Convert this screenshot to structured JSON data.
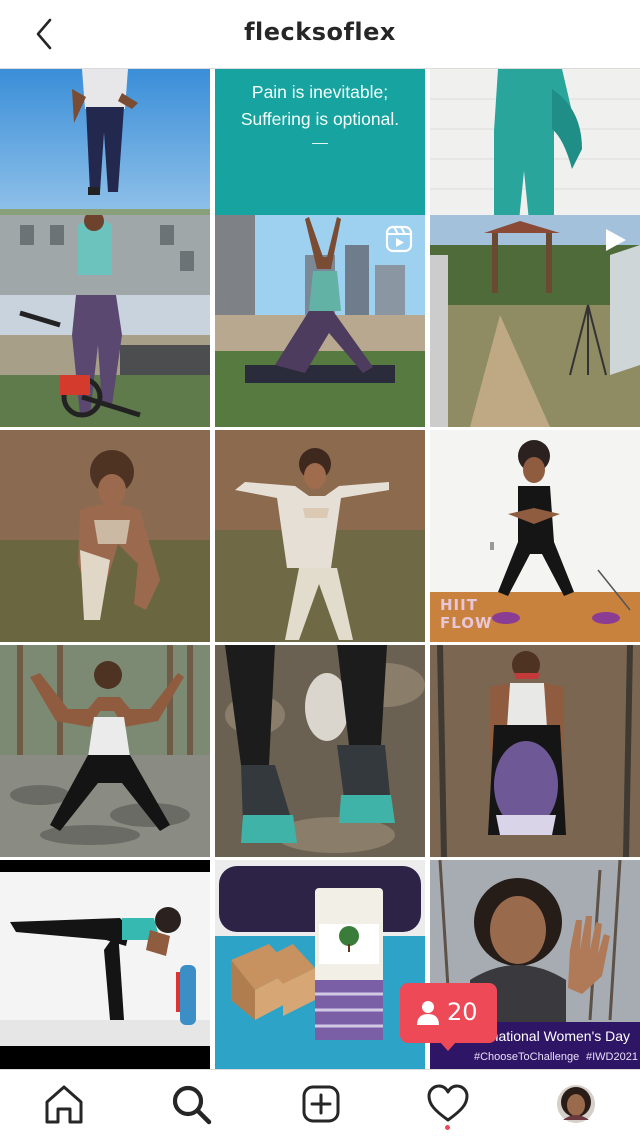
{
  "header": {
    "title": "flecksoflex",
    "back_icon": "chevron-left-icon"
  },
  "quote_tile": {
    "line1": "Pain is inevitable;",
    "line2": "Suffering is optional.",
    "bg": "#17a3a0"
  },
  "video_tile": {
    "overlay_text_1": "HIIT",
    "overlay_text_2": "FLOW"
  },
  "iwd_tile": {
    "title": "rnational Women's Day",
    "tag1": "#ChooseToChallenge",
    "tag2": "#IWD2021"
  },
  "notification_badge": {
    "count": "20",
    "icon": "person-icon",
    "color": "#ed4956"
  },
  "bottom_nav": {
    "items": [
      {
        "name": "home",
        "icon": "home-icon"
      },
      {
        "name": "search",
        "icon": "search-icon",
        "active": true
      },
      {
        "name": "new-post",
        "icon": "plus-square-icon"
      },
      {
        "name": "activity",
        "icon": "heart-icon",
        "has_notification_dot": true
      },
      {
        "name": "profile",
        "icon": "avatar"
      }
    ]
  },
  "posts": [
    {
      "type": "image",
      "description": "outdoor-field-workout"
    },
    {
      "type": "quote"
    },
    {
      "type": "image",
      "description": "teal-outfit"
    },
    {
      "type": "image",
      "description": "exercise-bike-rooftop"
    },
    {
      "type": "reel",
      "icon": "reels-icon",
      "description": "yoga-rooftop"
    },
    {
      "type": "video",
      "icon": "play-icon",
      "description": "trail-park"
    },
    {
      "type": "image",
      "description": "crouch-dry-grass"
    },
    {
      "type": "image",
      "description": "star-pose-grass"
    },
    {
      "type": "image",
      "description": "hiit-flow-indoor"
    },
    {
      "type": "image",
      "description": "goddess-pose-rocks"
    },
    {
      "type": "image",
      "description": "hiking-shoes"
    },
    {
      "type": "image",
      "description": "seated-blanket-woods"
    },
    {
      "type": "image",
      "description": "warrior-three-wall"
    },
    {
      "type": "image",
      "description": "yoga-props"
    },
    {
      "type": "image",
      "description": "iwd-wave"
    }
  ]
}
